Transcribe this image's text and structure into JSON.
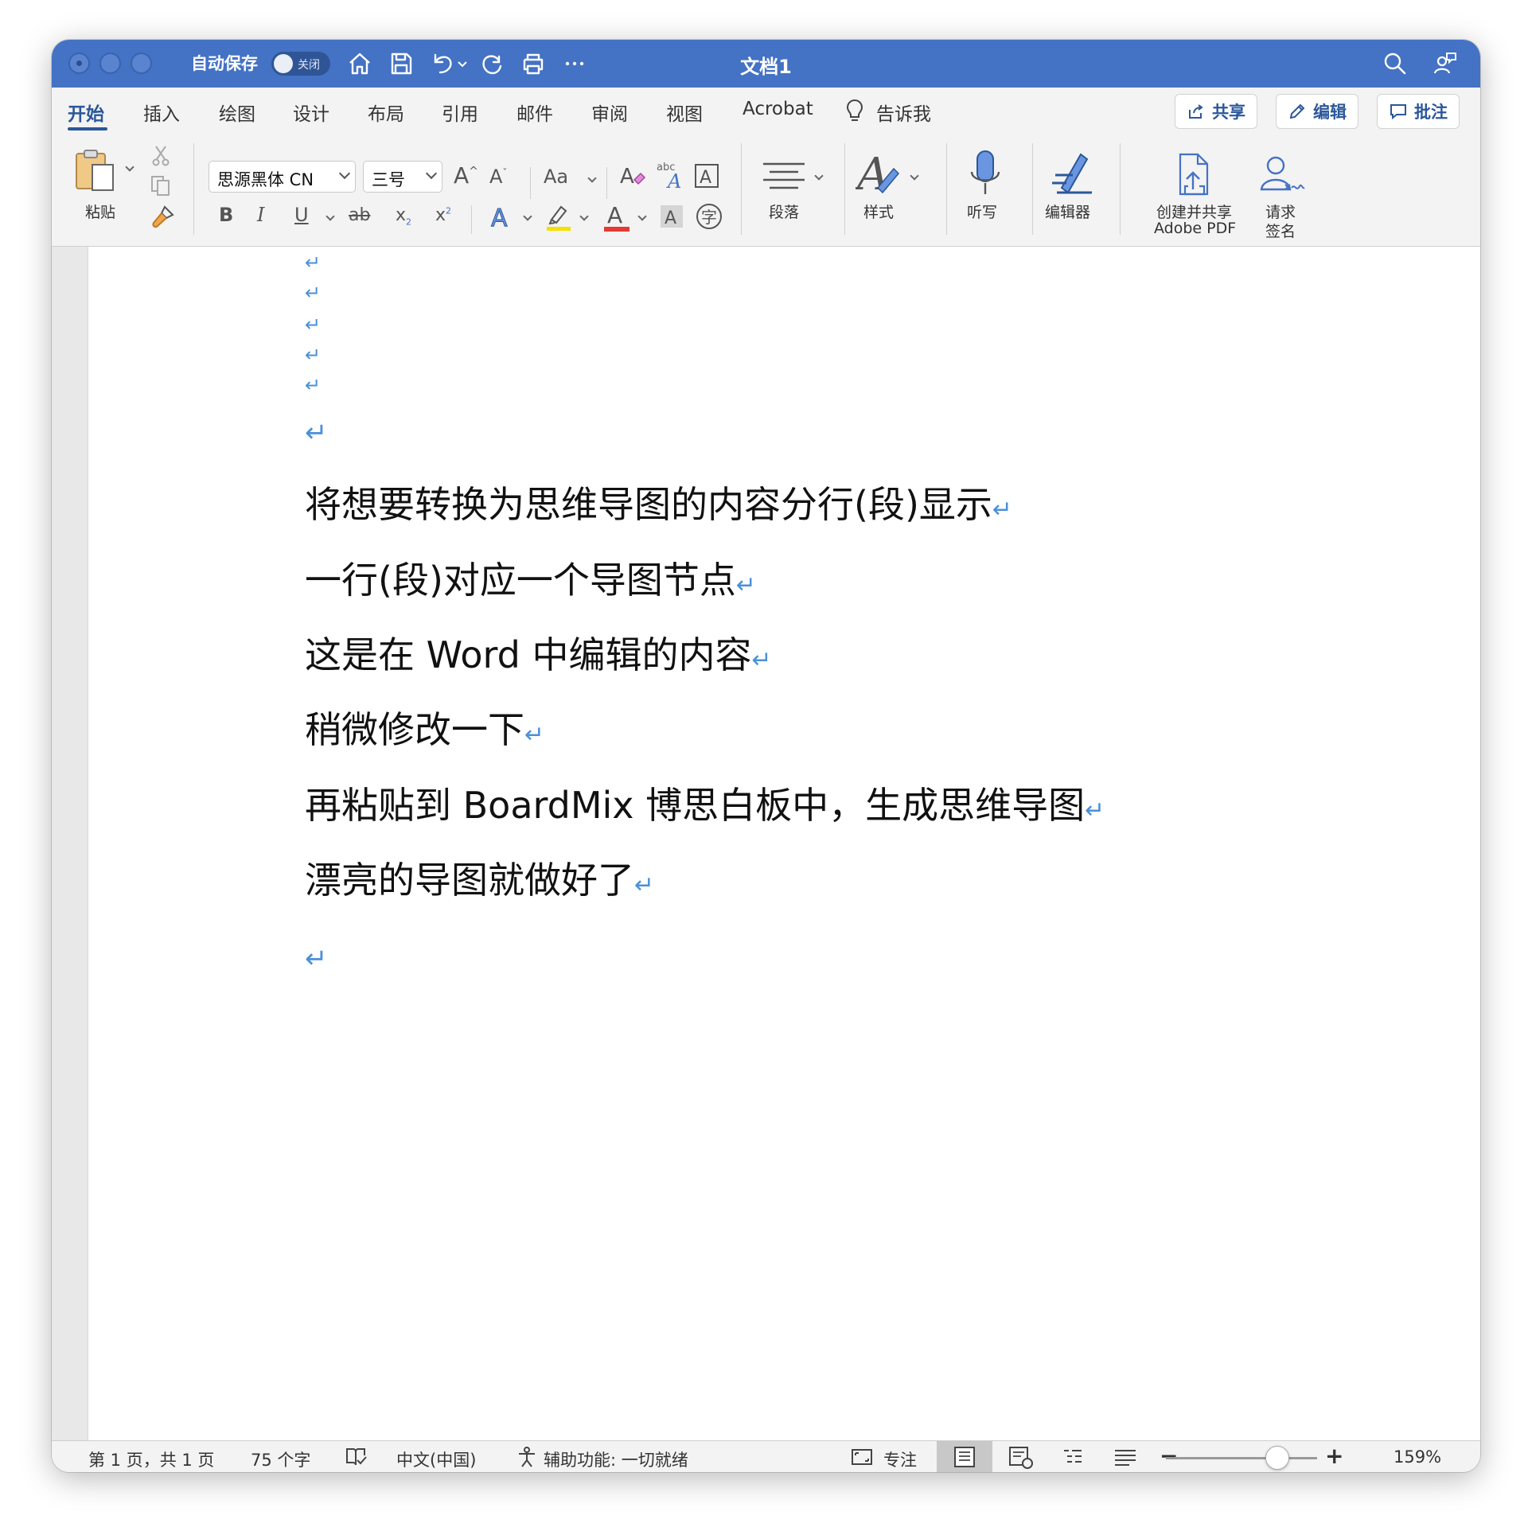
{
  "titlebar": {
    "autosave_label": "自动保存",
    "autosave_toggle": "关闭",
    "doc_title": "文档1"
  },
  "tabs": [
    "开始",
    "插入",
    "绘图",
    "设计",
    "布局",
    "引用",
    "邮件",
    "审阅",
    "视图",
    "Acrobat"
  ],
  "tell_me": "告诉我",
  "actions": {
    "share": "共享",
    "edit": "编辑",
    "comment": "批注"
  },
  "ribbon": {
    "paste_label": "粘贴",
    "font_name": "思源黑体 CN",
    "font_size": "三号",
    "case_label": "Aa",
    "paragraph_label": "段落",
    "styles_label": "样式",
    "dictate_label": "听写",
    "editor_label": "编辑器",
    "create_pdf_line1": "创建并共享",
    "create_pdf_line2": "Adobe PDF",
    "sign_line1": "请求",
    "sign_line2": "签名",
    "bold": "B",
    "italic": "I",
    "underline": "U",
    "strike": "ab",
    "subscript": "x",
    "superscript": "x",
    "font_color_letter": "A",
    "char_shading_letter": "A",
    "phonetic_char": "字",
    "highlight_color": "#f5e000",
    "font_color": "#e53935"
  },
  "document": {
    "lines": [
      "将想要转换为思维导图的内容分行(段)显示",
      "一行(段)对应一个导图节点",
      "这是在 Word 中编辑的内容",
      "稍微修改一下",
      "再粘贴到 BoardMix 博思白板中，生成思维导图",
      "漂亮的导图就做好了"
    ],
    "paragraph_mark": "↵"
  },
  "status": {
    "page": "第 1 页，共 1 页",
    "words": "75 个字",
    "language": "中文(中国)",
    "accessibility": "辅助功能: 一切就绪",
    "focus": "专注",
    "zoom": "159%"
  },
  "colors": {
    "titlebar": "#4472c4",
    "accent": "#2b579a",
    "para_mark": "#4a90d9"
  }
}
